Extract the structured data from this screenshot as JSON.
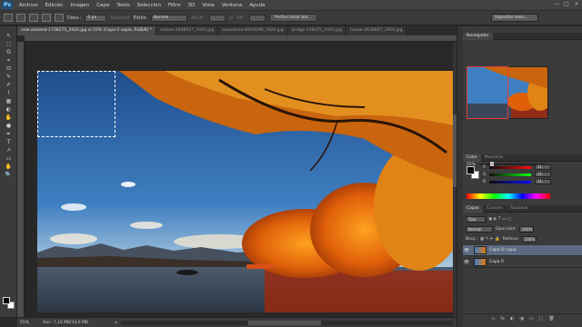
{
  "app": {
    "logo": "Ps"
  },
  "menu": [
    "Archivo",
    "Edición",
    "Imagen",
    "Capa",
    "Texto",
    "Selección",
    "Filtro",
    "3D",
    "Vista",
    "Ventana",
    "Ayuda"
  ],
  "window_controls": [
    "—",
    "□",
    "×"
  ],
  "options": {
    "feather_label": "Desv.:",
    "feather_value": "0 px",
    "smooth_label": "Suavizar",
    "style_label": "Estilo:",
    "style_value": "Normal",
    "width_label": "Anch.:",
    "height_label": "Alt.:",
    "refine_button": "Perfeccionar bor...",
    "workspace": "Aspectos esen..."
  },
  "tabs": [
    {
      "label": "new-zealand-1738275_1920.jpg al 55% (Capa 0 copia, RGB/8) *",
      "active": true
    },
    {
      "label": "ecbore-2466927_1920.jpg",
      "active": false
    },
    {
      "label": "mountains-6029596_1920.jpg",
      "active": false
    },
    {
      "label": "bridge-336475_1920.jpg",
      "active": false
    },
    {
      "label": "house-2636607_1920.jpg",
      "active": false
    }
  ],
  "tools": [
    "↖",
    "⬚",
    "ʘ",
    "⌖",
    "⊡",
    "✎",
    "✐",
    "⌇",
    "▦",
    "◐",
    "✋",
    "●",
    "✒",
    "T",
    "↗",
    "▭",
    "✋",
    "🔍"
  ],
  "status": {
    "zoom": "55%",
    "doc": "Doc: 7,10 MB/14,6 MB"
  },
  "navigator": {
    "title": "Navegador",
    "zoom": "55%"
  },
  "color_panel": {
    "tabs": [
      "Color",
      "Muestras"
    ],
    "channels": [
      {
        "name": "R",
        "value": "11",
        "color": "#e03a3a"
      },
      {
        "name": "G",
        "value": "11",
        "color": "#3ac83a"
      },
      {
        "name": "B",
        "value": "11",
        "color": "#3a5ae0"
      }
    ]
  },
  "layers_panel": {
    "tabs": [
      "Capas",
      "Canales",
      "Trazados"
    ],
    "kind_label": "Tipo",
    "blend_mode": "Normal",
    "opacity_label": "Opacidad:",
    "opacity_value": "100%",
    "lock_label": "Bloq.:",
    "fill_label": "Relleno:",
    "fill_value": "100%",
    "layers": [
      {
        "name": "Capa 0 copia",
        "active": true
      },
      {
        "name": "Capa 0",
        "active": false
      }
    ],
    "footer_icons": [
      "∞",
      "fx",
      "◐",
      "◑",
      "▭",
      "▢",
      "🗑"
    ]
  }
}
